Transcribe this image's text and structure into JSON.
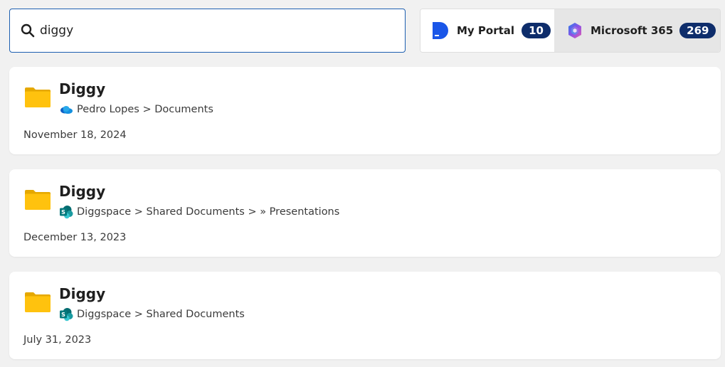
{
  "search": {
    "value": "diggy",
    "icon": "search-icon"
  },
  "tabs": [
    {
      "label": "My Portal",
      "count": "10",
      "icon": "my-portal-logo-icon",
      "selected": false
    },
    {
      "label": "Microsoft 365",
      "count": "269",
      "icon": "microsoft-365-logo-icon",
      "selected": true
    }
  ],
  "results": [
    {
      "title": "Diggy",
      "source_icon": "onedrive-icon",
      "path": "Pedro Lopes > Documents",
      "date": "November 18, 2024"
    },
    {
      "title": "Diggy",
      "source_icon": "sharepoint-icon",
      "path": "Diggspace > Shared Documents > » Presentations",
      "date": "December 13, 2023"
    },
    {
      "title": "Diggy",
      "source_icon": "sharepoint-icon",
      "path": "Diggspace > Shared Documents",
      "date": "July 31, 2023"
    }
  ],
  "colors": {
    "background": "#f1f1f1",
    "search_border": "#1d5fb0",
    "badge": "#0e2d6b",
    "folder": "#f5b800",
    "selected_tab": "#e6e6e6"
  }
}
